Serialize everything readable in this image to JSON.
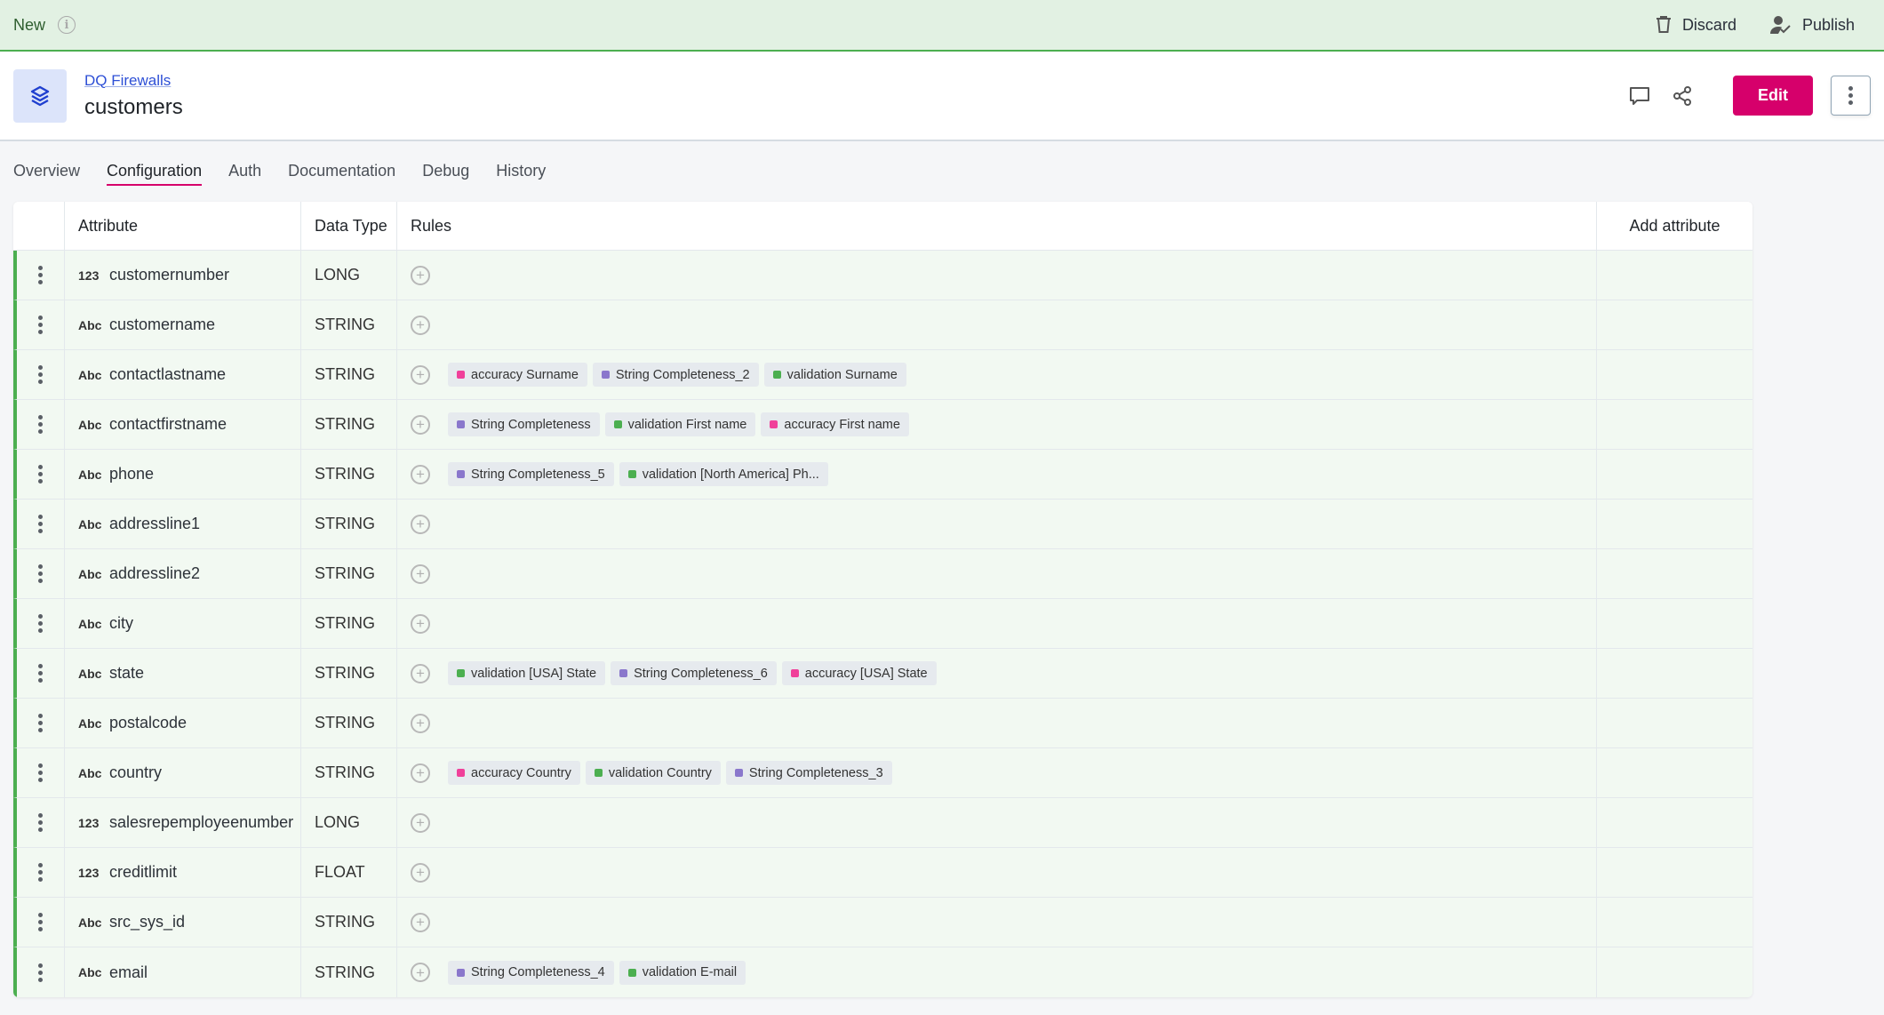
{
  "topbar": {
    "state_label": "New",
    "discard_label": "Discard",
    "publish_label": "Publish"
  },
  "header": {
    "breadcrumb": "DQ Firewalls",
    "title": "customers",
    "edit_label": "Edit"
  },
  "tabs": [
    {
      "label": "Overview",
      "active": false
    },
    {
      "label": "Configuration",
      "active": true
    },
    {
      "label": "Auth",
      "active": false
    },
    {
      "label": "Documentation",
      "active": false
    },
    {
      "label": "Debug",
      "active": false
    },
    {
      "label": "History",
      "active": false
    }
  ],
  "table": {
    "headers": {
      "attribute": "Attribute",
      "data_type": "Data Type",
      "rules": "Rules",
      "add": "Add attribute"
    },
    "rule_colors": {
      "accuracy": "#f0409a",
      "completeness": "#8a77cc",
      "validation": "#4caf50"
    },
    "rows": [
      {
        "type_badge": "123",
        "name": "customernumber",
        "data_type": "LONG",
        "rules": []
      },
      {
        "type_badge": "Abc",
        "name": "customername",
        "data_type": "STRING",
        "rules": []
      },
      {
        "type_badge": "Abc",
        "name": "contactlastname",
        "data_type": "STRING",
        "rules": [
          {
            "label": "accuracy Surname",
            "kind": "accuracy"
          },
          {
            "label": "String Completeness_2",
            "kind": "completeness"
          },
          {
            "label": "validation Surname",
            "kind": "validation"
          }
        ]
      },
      {
        "type_badge": "Abc",
        "name": "contactfirstname",
        "data_type": "STRING",
        "rules": [
          {
            "label": "String Completeness",
            "kind": "completeness"
          },
          {
            "label": "validation First name",
            "kind": "validation"
          },
          {
            "label": "accuracy First name",
            "kind": "accuracy"
          }
        ]
      },
      {
        "type_badge": "Abc",
        "name": "phone",
        "data_type": "STRING",
        "rules": [
          {
            "label": "String Completeness_5",
            "kind": "completeness"
          },
          {
            "label": "validation [North America] Ph...",
            "kind": "validation"
          }
        ]
      },
      {
        "type_badge": "Abc",
        "name": "addressline1",
        "data_type": "STRING",
        "rules": []
      },
      {
        "type_badge": "Abc",
        "name": "addressline2",
        "data_type": "STRING",
        "rules": []
      },
      {
        "type_badge": "Abc",
        "name": "city",
        "data_type": "STRING",
        "rules": []
      },
      {
        "type_badge": "Abc",
        "name": "state",
        "data_type": "STRING",
        "rules": [
          {
            "label": "validation [USA] State",
            "kind": "validation"
          },
          {
            "label": "String Completeness_6",
            "kind": "completeness"
          },
          {
            "label": "accuracy [USA] State",
            "kind": "accuracy"
          }
        ]
      },
      {
        "type_badge": "Abc",
        "name": "postalcode",
        "data_type": "STRING",
        "rules": []
      },
      {
        "type_badge": "Abc",
        "name": "country",
        "data_type": "STRING",
        "rules": [
          {
            "label": "accuracy Country",
            "kind": "accuracy"
          },
          {
            "label": "validation Country",
            "kind": "validation"
          },
          {
            "label": "String Completeness_3",
            "kind": "completeness"
          }
        ]
      },
      {
        "type_badge": "123",
        "name": "salesrepemployeenumber",
        "data_type": "LONG",
        "rules": []
      },
      {
        "type_badge": "123",
        "name": "creditlimit",
        "data_type": "FLOAT",
        "rules": []
      },
      {
        "type_badge": "Abc",
        "name": "src_sys_id",
        "data_type": "STRING",
        "rules": []
      },
      {
        "type_badge": "Abc",
        "name": "email",
        "data_type": "STRING",
        "rules": [
          {
            "label": "String Completeness_4",
            "kind": "completeness"
          },
          {
            "label": "validation E-mail",
            "kind": "validation"
          }
        ]
      }
    ]
  }
}
